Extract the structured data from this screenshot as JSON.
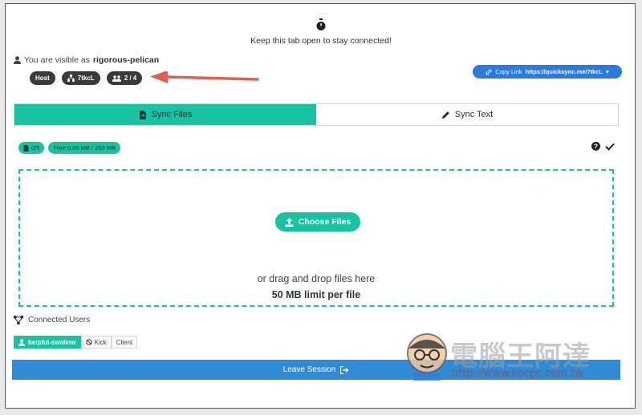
{
  "header": {
    "keep_open_message": "Keep this tab open to stay connected!",
    "visible_prefix": "You are visible as",
    "username": "rigorous-pelican"
  },
  "session_badges": {
    "role": "Host",
    "session_code": "7tkcL",
    "users_count": "2 / 4"
  },
  "copy_link": {
    "label": "Copy Link",
    "url": "https://quicksync.me/7tkcL"
  },
  "tabs": [
    {
      "label": "Sync Files",
      "active": true
    },
    {
      "label": "Sync Text",
      "active": false
    }
  ],
  "file_stats": {
    "count": "0/5",
    "storage": "Free 0.00 MB / 250 MB"
  },
  "dropzone": {
    "button_label": "Choose Files",
    "drag_text": "or drag and drop files here",
    "limit_text": "50 MB limit per file"
  },
  "connected_users": {
    "title": "Connected Users",
    "users": [
      {
        "name": "helpful-swallow",
        "kick_label": "Kick",
        "role": "Client"
      }
    ]
  },
  "leave_button": {
    "label": "Leave Session"
  },
  "watermark": {
    "text": "電腦王阿達",
    "url": "http://www.kocpc.com.tw"
  },
  "colors": {
    "accent_teal": "#17c3a0",
    "primary_blue": "#2f8bd5",
    "badge_dark": "#3a3a3a",
    "arrow_red": "#e0604f"
  },
  "icons": {
    "timer": "stopwatch-icon",
    "user": "user-icon",
    "network": "network-icon",
    "users": "users-icon",
    "link": "link-icon",
    "file_sync": "file-sync-icon",
    "pencil": "pencil-icon",
    "question": "question-icon",
    "check": "check-icon",
    "upload": "upload-icon",
    "ban": "ban-icon",
    "exit": "exit-icon"
  }
}
